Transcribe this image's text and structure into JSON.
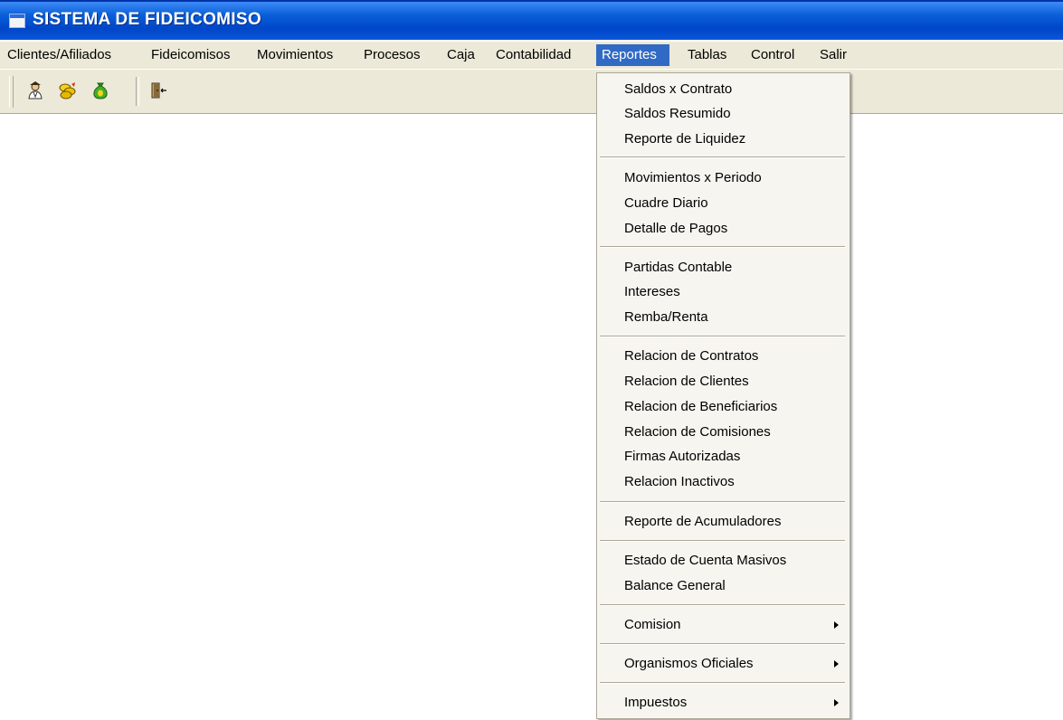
{
  "window": {
    "title": "SISTEMA DE FIDEICOMISO"
  },
  "menubar": {
    "items": [
      {
        "label": "Clientes/Afiliados"
      },
      {
        "label": "Fideicomisos"
      },
      {
        "label": "Movimientos"
      },
      {
        "label": "Procesos"
      },
      {
        "label": "Caja"
      },
      {
        "label": "Contabilidad"
      },
      {
        "label": "Reportes"
      },
      {
        "label": "Tablas"
      },
      {
        "label": "Control"
      },
      {
        "label": "Salir"
      }
    ],
    "active": "Reportes"
  },
  "toolbar": {
    "buttons": [
      {
        "icon": "person-icon"
      },
      {
        "icon": "coins-icon"
      },
      {
        "icon": "money-bag-icon"
      },
      {
        "icon": "exit-door-icon"
      }
    ]
  },
  "reportes_menu": {
    "items": [
      {
        "label": "Saldos x Contrato"
      },
      {
        "label": "Saldos Resumido"
      },
      {
        "label": "Reporte de Liquidez"
      },
      {
        "label": "Movimientos x Periodo"
      },
      {
        "label": "Cuadre Diario"
      },
      {
        "label": "Detalle de Pagos"
      },
      {
        "label": "Partidas Contable"
      },
      {
        "label": "Intereses"
      },
      {
        "label": "Remba/Renta"
      },
      {
        "label": "Relacion de Contratos"
      },
      {
        "label": "Relacion de Clientes"
      },
      {
        "label": "Relacion de Beneficiarios"
      },
      {
        "label": "Relacion de Comisiones"
      },
      {
        "label": "Firmas Autorizadas"
      },
      {
        "label": "Relacion Inactivos"
      },
      {
        "label": "Reporte de Acumuladores"
      },
      {
        "label": "Estado de Cuenta Masivos"
      },
      {
        "label": "Balance General"
      },
      {
        "label": "Comision",
        "submenu": true
      },
      {
        "label": "Organismos Oficiales",
        "submenu": true
      },
      {
        "label": "Impuestos",
        "submenu": true
      }
    ]
  },
  "colors": {
    "titlebar": "#0a5fd8",
    "menu_highlight": "#316ac5",
    "chrome": "#ece9d8"
  }
}
